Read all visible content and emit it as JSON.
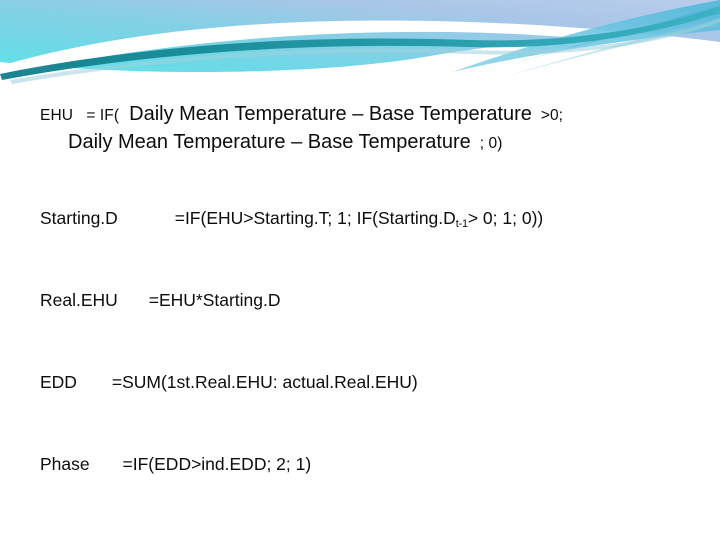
{
  "slide": {
    "background_color": "#ffffff",
    "text_color": "#0d0d0d",
    "banner": {
      "name": "wave-banner",
      "colors": {
        "cyan_bright": "#5fe2e8",
        "cyan_mid": "#7fd4e4",
        "blue_soft": "#9fc4e8",
        "teal_line": "#11808c",
        "teal_band": "#3fb6c8",
        "white": "#ffffff"
      }
    }
  },
  "formulas": {
    "ehu": {
      "name": "EHU",
      "line1_label": "EHU",
      "line1_op": "= IF(",
      "line1_body": "Daily Mean Temperature – Base Temperature",
      "line1_tail": ">0;",
      "line2_body": "Daily Mean Temperature – Base Temperature",
      "line2_tail": "; 0)"
    },
    "starting_d": {
      "label": "Starting.D",
      "expr_pre": "=IF(EHU>Starting.T; 1; IF(Starting.D",
      "expr_sub": "t-1",
      "expr_post": "> 0; 1; 0))"
    },
    "real_ehu": {
      "label": "Real.EHU",
      "expr": "=EHU*Starting.D"
    },
    "edd": {
      "label": "EDD",
      "expr": "=SUM(1st.Real.EHU: actual.Real.EHU)"
    },
    "phase": {
      "label": "Phase",
      "expr": "=IF(EDD>ind.EDD; 2; 1)"
    }
  }
}
